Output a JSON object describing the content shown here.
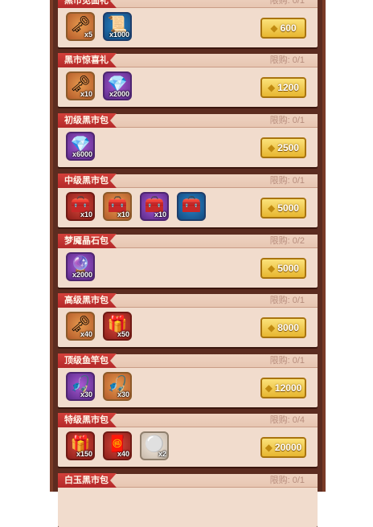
{
  "sections": [
    {
      "title": "黑市见面礼",
      "limit": "限购: 0/1",
      "price": "600",
      "items": [
        {
          "icon": "key-blade-icon",
          "color": "orange",
          "qty": "x5"
        },
        {
          "icon": "rune-scroll-icon",
          "color": "blue",
          "qty": "x1000"
        }
      ]
    },
    {
      "title": "黑市惊喜礼",
      "limit": "限购: 0/1",
      "price": "1200",
      "items": [
        {
          "icon": "key-blade-icon",
          "color": "orange",
          "qty": "x10"
        },
        {
          "icon": "crystal-shard-icon",
          "color": "purple",
          "qty": "x2000"
        }
      ]
    },
    {
      "title": "初级黑市包",
      "limit": "限购: 0/1",
      "price": "2500",
      "items": [
        {
          "icon": "crystal-shard-icon",
          "color": "purple",
          "qty": "x6000"
        }
      ]
    },
    {
      "title": "中级黑市包",
      "limit": "限购: 0/1",
      "price": "5000",
      "items": [
        {
          "icon": "treasure-chest-icon",
          "color": "red",
          "qty": "x10"
        },
        {
          "icon": "treasure-chest-icon",
          "color": "orange",
          "qty": "x10"
        },
        {
          "icon": "treasure-chest-icon",
          "color": "purple",
          "qty": "x10"
        },
        {
          "icon": "treasure-chest-icon",
          "color": "blue",
          "qty": ""
        }
      ]
    },
    {
      "title": "梦魇晶石包",
      "limit": "限购: 0/2",
      "price": "5000",
      "items": [
        {
          "icon": "nightmare-crystal-icon",
          "color": "purple",
          "qty": "x2000"
        }
      ]
    },
    {
      "title": "高级黑市包",
      "limit": "限购: 0/1",
      "price": "8000",
      "items": [
        {
          "icon": "key-blade-icon",
          "color": "orange",
          "qty": "x40"
        },
        {
          "icon": "gift-box-icon",
          "color": "red",
          "qty": "x50"
        }
      ]
    },
    {
      "title": "顶级鱼竿包",
      "limit": "限购: 0/1",
      "price": "12000",
      "items": [
        {
          "icon": "fishing-rod-icon",
          "color": "purple",
          "qty": "x30"
        },
        {
          "icon": "fishing-rod-icon",
          "color": "orange",
          "qty": "x30"
        }
      ]
    },
    {
      "title": "特级黑市包",
      "limit": "限购: 0/4",
      "price": "20000",
      "items": [
        {
          "icon": "gift-box-icon",
          "color": "red",
          "qty": "x150"
        },
        {
          "icon": "scroll-bundle-icon",
          "color": "red",
          "qty": "x40"
        },
        {
          "icon": "pearl-icon",
          "color": "white",
          "qty": "x2"
        }
      ]
    },
    {
      "title": "白玉黑市包",
      "limit": "限购: 0/1",
      "price": "",
      "items": []
    }
  ]
}
